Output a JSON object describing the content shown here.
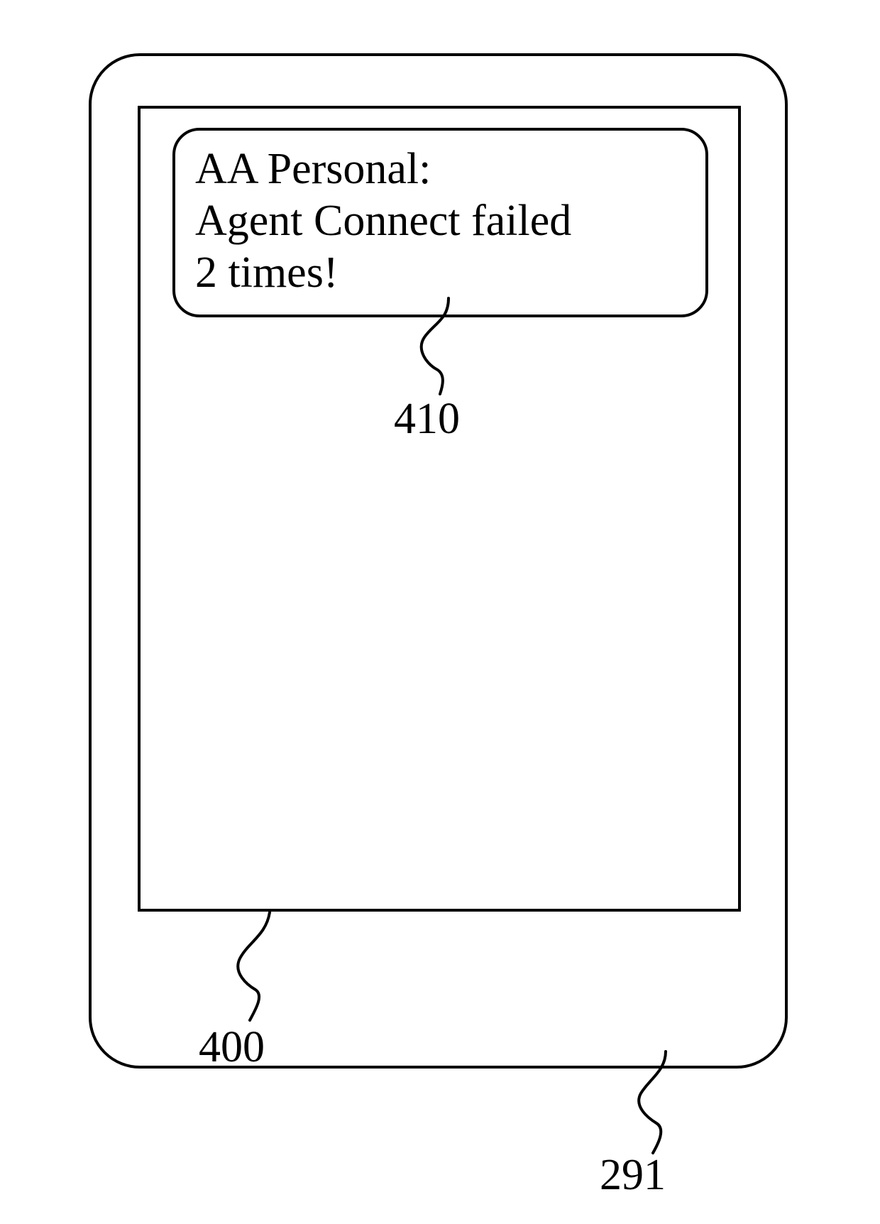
{
  "notification": {
    "line1": "AA Personal:",
    "line2": "Agent Connect failed",
    "line3": "2 times!"
  },
  "labels": {
    "notification_ref": "410",
    "screen_ref": "400",
    "device_ref": "291"
  }
}
